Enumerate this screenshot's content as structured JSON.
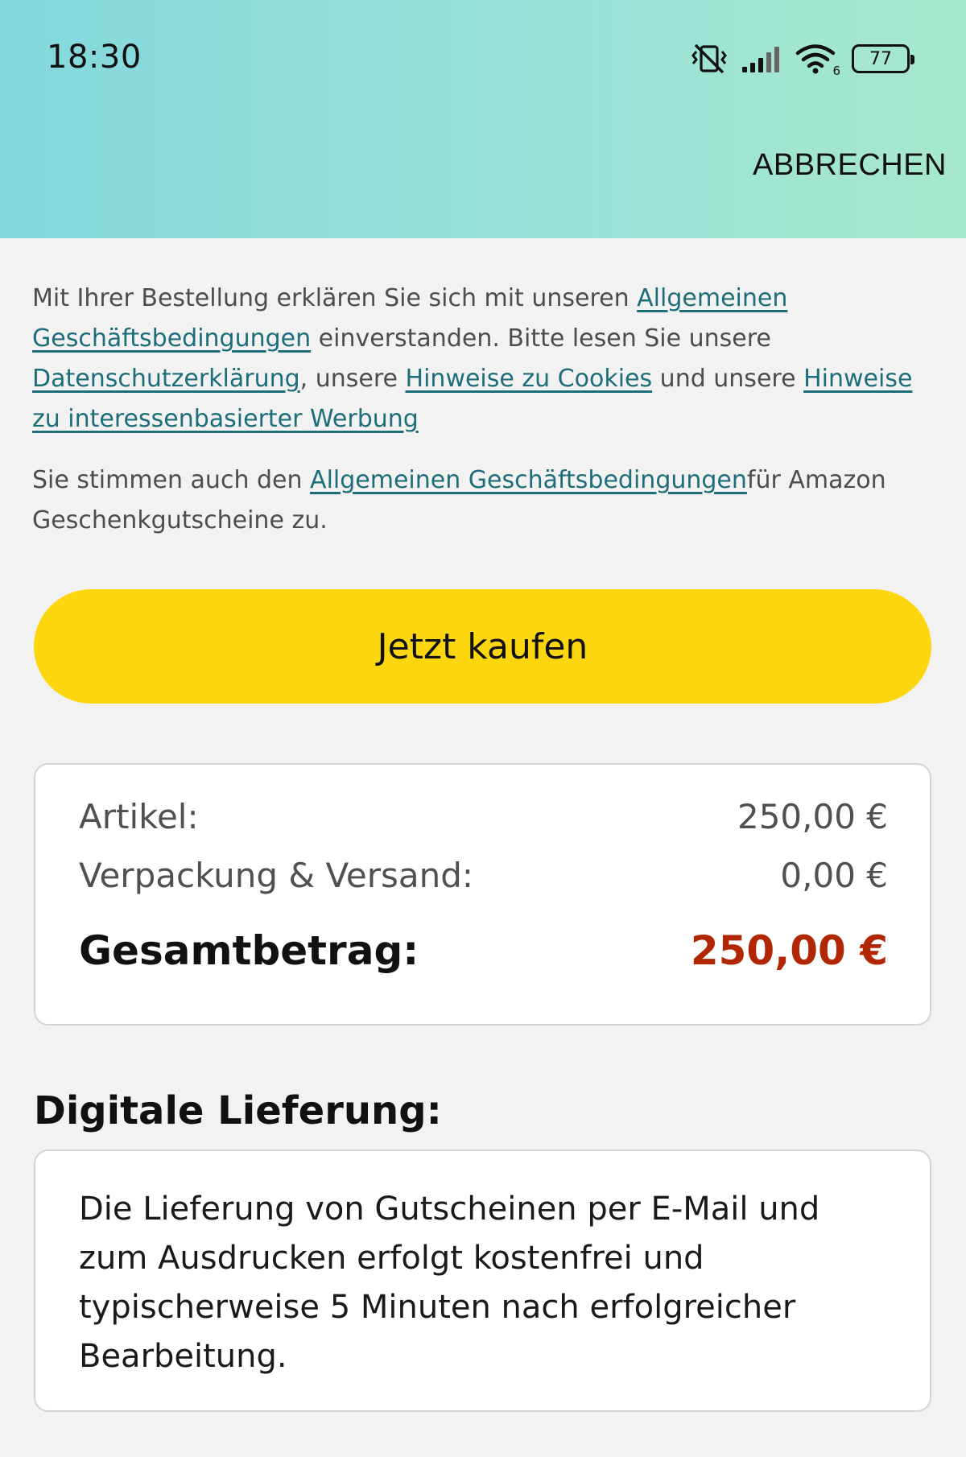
{
  "status_bar": {
    "time": "18:30",
    "battery": "77",
    "wifi_badge": "6"
  },
  "header": {
    "cancel_label": "ABBRECHEN"
  },
  "legal": {
    "p1_part1": "Mit Ihrer Bestellung erklären Sie sich mit unseren ",
    "p1_link_agb": "Allgemeinen Geschäftsbedingungen",
    "p1_part2": " einverstanden. Bitte lesen Sie unsere ",
    "p1_link_privacy": "Datenschutzerklärung",
    "p1_part3": ", unsere ",
    "p1_link_cookies": "Hinweise zu Cookies",
    "p1_part4": " und unsere ",
    "p1_link_ads": "Hinweise zu interessenbasierter Werbung",
    "p2_part1": "Sie stimmen auch den ",
    "p2_link_agb": "Allgemeinen Geschäftsbedingungen",
    "p2_part2": "für Amazon Geschenkgutscheine zu."
  },
  "buy_button_label": "Jetzt kaufen",
  "summary": {
    "items_label": "Artikel:",
    "items_value": "250,00 €",
    "shipping_label": "Verpackung & Versand:",
    "shipping_value": "0,00 €",
    "total_label": "Gesamtbetrag:",
    "total_value": "250,00 €"
  },
  "delivery": {
    "title": "Digitale Lieferung:",
    "text": "Die Lieferung von Gutscheinen per E-Mail und zum Ausdrucken erfolgt kostenfrei und typischerweise 5 Minuten nach erfolgreicher Bearbeitung."
  },
  "colors": {
    "link": "#1d6e78",
    "buy_button": "#fcd60f",
    "total_price": "#b12704",
    "header_gradient_start": "#83d8dd",
    "header_gradient_end": "#a7e8cc"
  },
  "icons": [
    "vibrate-off-icon",
    "signal-icon",
    "wifi-icon",
    "battery-icon"
  ]
}
